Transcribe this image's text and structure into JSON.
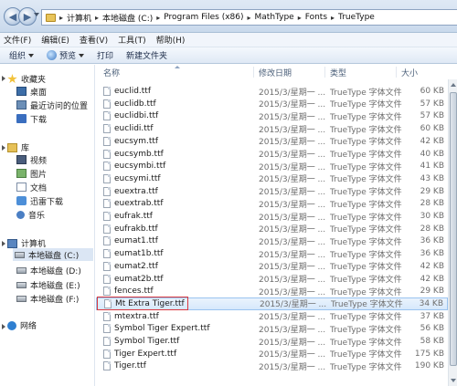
{
  "address": {
    "crumbs": [
      "计算机",
      "本地磁盘 (C:)",
      "Program Files (x86)",
      "MathType",
      "Fonts",
      "TrueType"
    ]
  },
  "menu": [
    "文件(F)",
    "编辑(E)",
    "查看(V)",
    "工具(T)",
    "帮助(H)"
  ],
  "toolbar": {
    "organize": "组织",
    "preview": "预览",
    "print": "打印",
    "new_folder": "新建文件夹"
  },
  "nav": {
    "favorites": "收藏夹",
    "fav_items": [
      "桌面",
      "最近访问的位置",
      "下载"
    ],
    "libraries": "库",
    "lib_items": [
      "视频",
      "图片",
      "文档",
      "迅雷下载",
      "音乐"
    ],
    "computer": "计算机",
    "drives": [
      "本地磁盘 (C:)",
      "本地磁盘 (D:)",
      "本地磁盘 (E:)",
      "本地磁盘 (F:)"
    ],
    "network": "网络"
  },
  "columns": {
    "name": "名称",
    "date": "修改日期",
    "type": "类型",
    "size": "大小"
  },
  "files": [
    {
      "name": "euclid.ttf",
      "date": "2015/3/星期一 ...",
      "type": "TrueType 字体文件",
      "size": "60 KB"
    },
    {
      "name": "euclidb.ttf",
      "date": "2015/3/星期一 ...",
      "type": "TrueType 字体文件",
      "size": "57 KB"
    },
    {
      "name": "euclidbi.ttf",
      "date": "2015/3/星期一 ...",
      "type": "TrueType 字体文件",
      "size": "57 KB"
    },
    {
      "name": "euclidi.ttf",
      "date": "2015/3/星期一 ...",
      "type": "TrueType 字体文件",
      "size": "60 KB"
    },
    {
      "name": "eucsym.ttf",
      "date": "2015/3/星期一 ...",
      "type": "TrueType 字体文件",
      "size": "42 KB"
    },
    {
      "name": "eucsymb.ttf",
      "date": "2015/3/星期一 ...",
      "type": "TrueType 字体文件",
      "size": "40 KB"
    },
    {
      "name": "eucsymbi.ttf",
      "date": "2015/3/星期一 ...",
      "type": "TrueType 字体文件",
      "size": "41 KB"
    },
    {
      "name": "eucsymi.ttf",
      "date": "2015/3/星期一 ...",
      "type": "TrueType 字体文件",
      "size": "43 KB"
    },
    {
      "name": "euextra.ttf",
      "date": "2015/3/星期一 ...",
      "type": "TrueType 字体文件",
      "size": "29 KB"
    },
    {
      "name": "euextrab.ttf",
      "date": "2015/3/星期一 ...",
      "type": "TrueType 字体文件",
      "size": "28 KB"
    },
    {
      "name": "eufrak.ttf",
      "date": "2015/3/星期一 ...",
      "type": "TrueType 字体文件",
      "size": "30 KB"
    },
    {
      "name": "eufrakb.ttf",
      "date": "2015/3/星期一 ...",
      "type": "TrueType 字体文件",
      "size": "28 KB"
    },
    {
      "name": "eumat1.ttf",
      "date": "2015/3/星期一 ...",
      "type": "TrueType 字体文件",
      "size": "36 KB"
    },
    {
      "name": "eumat1b.ttf",
      "date": "2015/3/星期一 ...",
      "type": "TrueType 字体文件",
      "size": "36 KB"
    },
    {
      "name": "eumat2.ttf",
      "date": "2015/3/星期一 ...",
      "type": "TrueType 字体文件",
      "size": "42 KB"
    },
    {
      "name": "eumat2b.ttf",
      "date": "2015/3/星期一 ...",
      "type": "TrueType 字体文件",
      "size": "42 KB"
    },
    {
      "name": "fences.ttf",
      "date": "2015/3/星期一 ...",
      "type": "TrueType 字体文件",
      "size": "29 KB"
    },
    {
      "name": "Mt Extra Tiger.ttf",
      "date": "2015/3/星期一 ...",
      "type": "TrueType 字体文件",
      "size": "34 KB"
    },
    {
      "name": "mtextra.ttf",
      "date": "2015/3/星期一 ...",
      "type": "TrueType 字体文件",
      "size": "37 KB"
    },
    {
      "name": "Symbol Tiger Expert.ttf",
      "date": "2015/3/星期一 ...",
      "type": "TrueType 字体文件",
      "size": "56 KB"
    },
    {
      "name": "Symbol Tiger.ttf",
      "date": "2015/3/星期一 ...",
      "type": "TrueType 字体文件",
      "size": "58 KB"
    },
    {
      "name": "Tiger Expert.ttf",
      "date": "2015/3/星期一 ...",
      "type": "TrueType 字体文件",
      "size": "175 KB"
    },
    {
      "name": "Tiger.ttf",
      "date": "2015/3/星期一 ...",
      "type": "TrueType 字体文件",
      "size": "190 KB"
    }
  ],
  "selected_file": "Mt Extra Tiger.ttf",
  "colors": {
    "selection_fill": "#d6e8fb",
    "selection_border": "#99c3ef",
    "highlight_box": "#d9383f"
  }
}
